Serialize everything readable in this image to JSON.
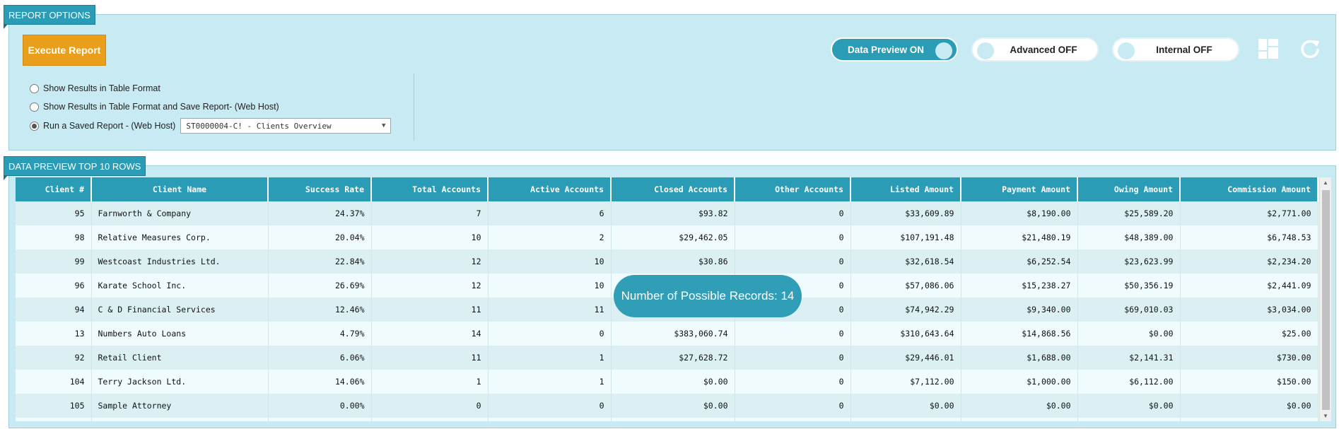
{
  "report_options": {
    "tab_label": "REPORT OPTIONS",
    "execute_label": "Execute Report",
    "radio_options": [
      {
        "label": "Show Results in Table Format",
        "checked": false
      },
      {
        "label": "Show Results in Table Format and Save Report- (Web Host)",
        "checked": false
      },
      {
        "label": "Run a Saved Report - (Web Host)",
        "checked": true
      }
    ],
    "saved_report_select": "ST0000004-C! - Clients Overview",
    "toggles": {
      "data_preview": {
        "label": "Data Preview ON",
        "state": "on"
      },
      "advanced": {
        "label": "Advanced OFF",
        "state": "off"
      },
      "internal": {
        "label": "Internal OFF",
        "state": "off"
      }
    },
    "icons": [
      "layout-grid-icon",
      "refresh-icon"
    ]
  },
  "data_preview": {
    "tab_label": "DATA PREVIEW TOP 10 ROWS",
    "columns": [
      "Client #",
      "Client Name",
      "Success Rate",
      "Total Accounts",
      "Active Accounts",
      "Closed Accounts",
      "Other Accounts",
      "Listed Amount",
      "Payment Amount",
      "Owing Amount",
      "Commission Amount"
    ],
    "rows": [
      [
        "95",
        "Farnworth & Company",
        "24.37%",
        "7",
        "6",
        "$93.82",
        "0",
        "$33,609.89",
        "$8,190.00",
        "$25,589.20",
        "$2,771.00"
      ],
      [
        "98",
        "Relative Measures Corp.",
        "20.04%",
        "10",
        "2",
        "$29,462.05",
        "0",
        "$107,191.48",
        "$21,480.19",
        "$48,389.00",
        "$6,748.53"
      ],
      [
        "99",
        "Westcoast Industries Ltd.",
        "22.84%",
        "12",
        "10",
        "$30.86",
        "0",
        "$32,618.54",
        "$6,252.54",
        "$23,623.99",
        "$2,234.20"
      ],
      [
        "96",
        "Karate School Inc.",
        "26.69%",
        "12",
        "10",
        "",
        "0",
        "$57,086.06",
        "$15,238.27",
        "$50,356.19",
        "$2,441.09"
      ],
      [
        "94",
        "C & D Financial Services",
        "12.46%",
        "11",
        "11",
        "",
        "0",
        "$74,942.29",
        "$9,340.00",
        "$69,010.03",
        "$3,034.00"
      ],
      [
        "13",
        "Numbers Auto Loans",
        "4.79%",
        "14",
        "0",
        "$383,060.74",
        "0",
        "$310,643.64",
        "$14,868.56",
        "$0.00",
        "$25.00"
      ],
      [
        "92",
        "Retail Client",
        "6.06%",
        "11",
        "1",
        "$27,628.72",
        "0",
        "$29,446.01",
        "$1,688.00",
        "$2,141.31",
        "$730.00"
      ],
      [
        "104",
        "Terry Jackson Ltd.",
        "14.06%",
        "1",
        "1",
        "$0.00",
        "0",
        "$7,112.00",
        "$1,000.00",
        "$6,112.00",
        "$150.00"
      ],
      [
        "105",
        "Sample Attorney",
        "0.00%",
        "0",
        "0",
        "$0.00",
        "0",
        "$0.00",
        "$0.00",
        "$0.00",
        "$0.00"
      ],
      [
        "",
        "",
        "",
        "",
        "",
        "",
        "",
        "",
        "",
        "",
        ""
      ]
    ],
    "records_badge": "Number of Possible Records: 14"
  },
  "colors": {
    "accent": "#2b9cb5",
    "panel_bg": "#c8eaf2",
    "execute_button": "#e99f1c"
  }
}
